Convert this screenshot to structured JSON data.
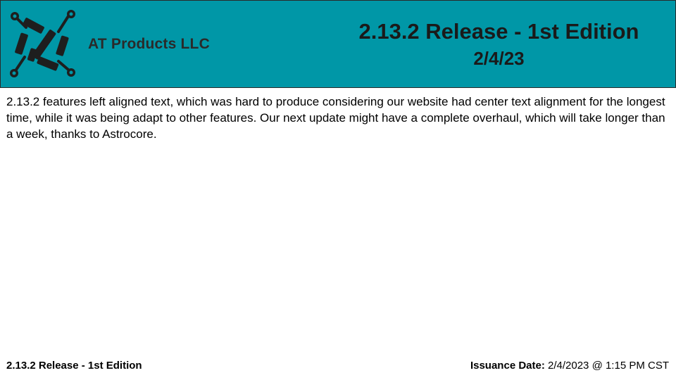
{
  "header": {
    "company_name": "AT Products LLC",
    "logo_icon": "circuit-logo-icon",
    "title": "2.13.2 Release - 1st Edition",
    "date": "2/4/23"
  },
  "body": {
    "text": "2.13.2 features left aligned text, which was hard to produce considering our website had center text alignment for the longest time, while it was being adapt to other features. Our next update might have a complete overhaul, which will take longer than a week, thanks to Astrocore."
  },
  "footer": {
    "left": "2.13.2 Release - 1st Edition",
    "issuance_label": "Issuance Date:",
    "issuance_value": "2/4/2023 @ 1:15 PM CST"
  },
  "colors": {
    "header_background": "#0097a7",
    "logo_color": "#1e1e1e"
  }
}
